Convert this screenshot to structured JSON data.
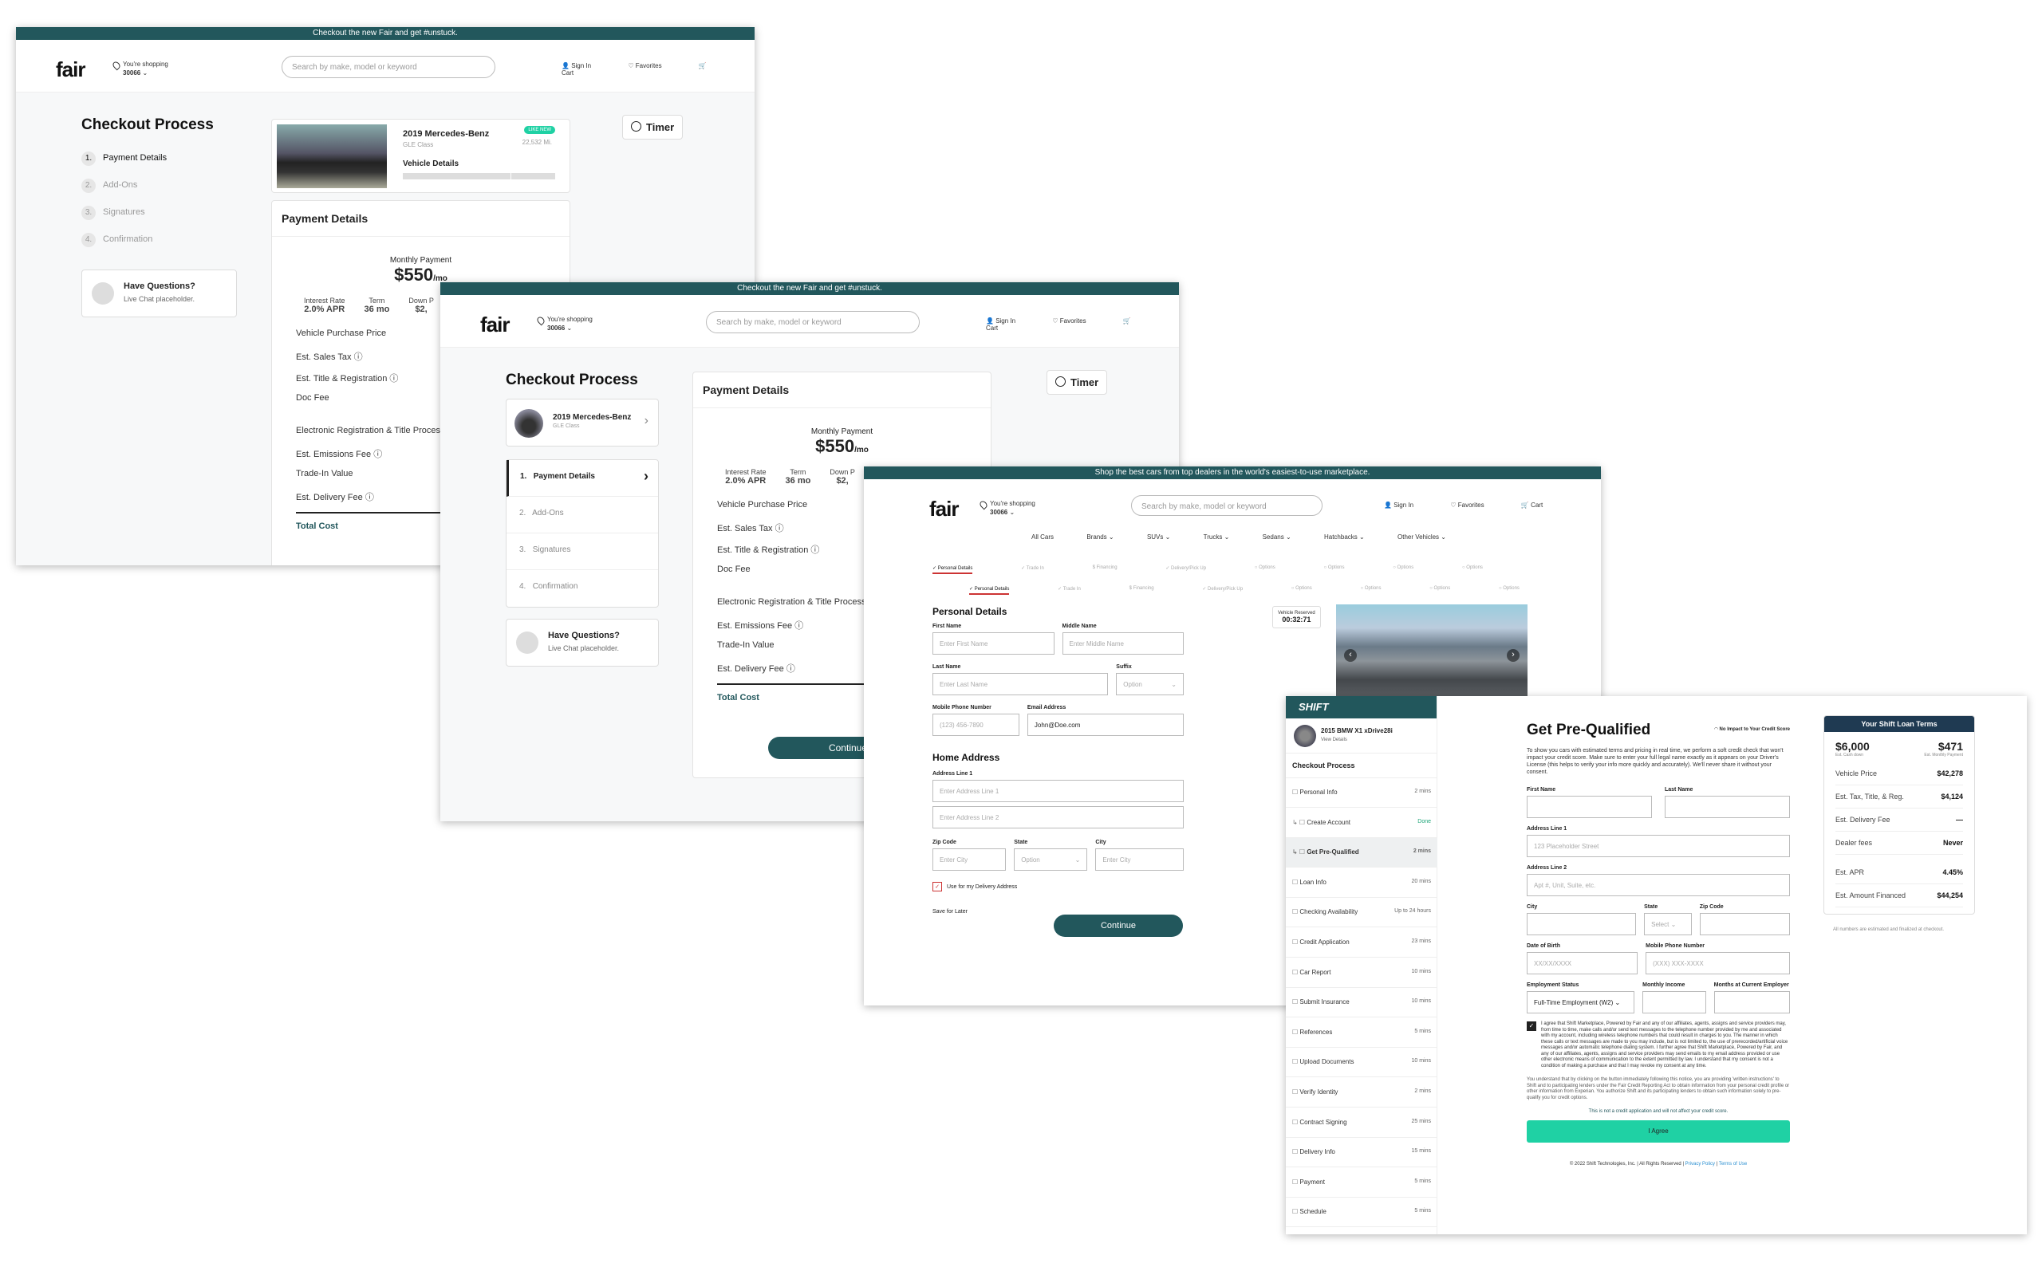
{
  "brand": {
    "logo": "fair",
    "primary": "#22575c",
    "accent": "#1fd1a4",
    "shift_logo": "SHIFT"
  },
  "promo_fair": "Checkout the new Fair and get #unstuck.",
  "promo_shift": "Shop the best cars from top dealers in the world's easiest-to-use marketplace.",
  "header": {
    "shopping_label": "You're shopping",
    "zip": "30066",
    "search_placeholder": "Search by make, model or keyword",
    "sign_in": "Sign In",
    "favorites": "Favorites",
    "cart": "Cart"
  },
  "checkout": {
    "title": "Checkout Process",
    "steps": [
      {
        "num": "1.",
        "label": "Payment Details"
      },
      {
        "num": "2.",
        "label": "Add-Ons"
      },
      {
        "num": "3.",
        "label": "Signatures"
      },
      {
        "num": "4.",
        "label": "Confirmation"
      }
    ],
    "questions_title": "Have Questions?",
    "questions_sub": "Live Chat placeholder.",
    "timer": "Timer"
  },
  "vehicle": {
    "name": "2019 Mercedes-Benz",
    "trim": "GLE Class",
    "badge": "LIKE NEW",
    "miles": "22,532 Mi.",
    "details_label": "Vehicle Details"
  },
  "payment": {
    "title": "Payment Details",
    "monthly_label": "Monthly Payment",
    "monthly_value": "$550",
    "monthly_unit": "/mo",
    "interest_label": "Interest Rate",
    "interest_value": "2.0% APR",
    "term_label": "Term",
    "term_value": "36 mo",
    "down_label": "Down P",
    "down_value": "$2,",
    "lines": [
      "Vehicle Purchase Price",
      "Est. Sales Tax",
      "Est. Title & Registration",
      "Doc Fee",
      "Electronic Registration & Title Processin",
      "Est. Emissions Fee",
      "Trade-In Value",
      "Est. Delivery Fee"
    ],
    "total": "Total Cost",
    "continue": "Continue"
  },
  "form": {
    "categories": [
      "All Cars",
      "Brands",
      "SUVs",
      "Trucks",
      "Sedans",
      "Hatchbacks",
      "Other Vehicles"
    ],
    "tabs": [
      "Personal Details",
      "Trade In",
      "Financing",
      "Delivery/Pick Up",
      "Options",
      "Options",
      "Options",
      "Options"
    ],
    "section_personal": "Personal Details",
    "first_name": "First Name",
    "first_ph": "Enter First Name",
    "middle_name": "Middle Name",
    "middle_ph": "Enter Middle Name",
    "last_name": "Last Name",
    "last_ph": "Enter Last Name",
    "suffix": "Suffix",
    "suffix_ph": "Option",
    "phone": "Mobile Phone Number",
    "phone_ph": "(123) 456-7890",
    "email": "Email Address",
    "email_val": "John@Doe.com",
    "section_home": "Home Address",
    "addr1": "Address Line 1",
    "addr1_ph": "Enter Address Line 1",
    "addr2_ph": "Enter Address Line 2",
    "zip": "Zip Code",
    "zip_ph": "Enter City",
    "state": "State",
    "state_ph": "Option",
    "city": "City",
    "city_ph": "Enter City",
    "delivery_check": "Use for my Delivery Address",
    "save_later": "Save for Later",
    "continue": "Continue",
    "reserved_label": "Vehicle Reserved",
    "reserved_time": "00:32:71"
  },
  "shift": {
    "car": "2015 BMW X1 xDrive28i",
    "view_details": "View Details",
    "checkout": "Checkout Process",
    "steps": [
      {
        "label": "Personal Info",
        "time": "2 mins"
      },
      {
        "label": "Create Account",
        "time": "Done"
      },
      {
        "label": "Get Pre-Qualified",
        "time": "2 mins"
      },
      {
        "label": "Loan Info",
        "time": "20 mins"
      },
      {
        "label": "Checking Availability",
        "time": "Up to 24 hours"
      },
      {
        "label": "Credit Application",
        "time": "23 mins"
      },
      {
        "label": "Car Report",
        "time": "10 mins"
      },
      {
        "label": "Submit Insurance",
        "time": "10 mins"
      },
      {
        "label": "References",
        "time": "5 mins"
      },
      {
        "label": "Upload Documents",
        "time": "10 mins"
      },
      {
        "label": "Verify Identity",
        "time": "2 mins"
      },
      {
        "label": "Contract Signing",
        "time": "25 mins"
      },
      {
        "label": "Delivery Info",
        "time": "15 mins"
      },
      {
        "label": "Payment",
        "time": "5 mins"
      },
      {
        "label": "Schedule",
        "time": "5 mins"
      }
    ],
    "title": "Get Pre-Qualified",
    "no_impact": "No Impact to Your Credit Score",
    "intro": "To show you cars with estimated terms and pricing in real time, we perform a soft credit check that won't impact your credit score. Make sure to enter your full legal name exactly as it appears on your Driver's License (this helps to verify your info more quickly and accurately). We'll never share it without your consent.",
    "first_name": "First Name",
    "last_name": "Last Name",
    "addr1": "Address Line 1",
    "addr1_ph": "123 Placeholder Street",
    "addr2": "Address Line 2",
    "addr2_ph": "Apt #, Unit, Suite, etc.",
    "city": "City",
    "state": "State",
    "state_ph": "Select",
    "zip": "Zip Code",
    "dob": "Date of Birth",
    "dob_ph": "XX/XX/XXXX",
    "phone": "Mobile Phone Number",
    "phone_ph": "(XXX) XXX-XXXX",
    "employment": "Employment Status",
    "employment_val": "Full-Time Employment (W2)",
    "income": "Monthly Income",
    "months": "Months at Current Employer",
    "consent": "I agree that Shift Marketplace, Powered by Fair and any of our affiliates, agents, assigns and service providers may, from time to time, make calls and/or send text messages to the telephone number provided by me and associated with my account, including wireless telephone numbers that could result in charges to you. The manner in which these calls or text messages are made to you may include, but is not limited to, the use of prerecorded/artificial voice messages and/or automatic telephone dialing system. I further agree that Shift Marketplace, Powered by Fair, and any of our affiliates, agents, assigns and service providers may send emails to my email address provided or use other electronic means of communication to the extent permitted by law. I understand that my consent is not a condition of making a purchase and that I may revoke my consent at any time.",
    "fcra": "You understand that by clicking on the button immediately following this notice, you are providing 'written instructions' to Shift and to participating lenders under the Fair Credit Reporting Act to obtain information from your personal credit profile or other information from Experian. You authorize Shift and its participating lenders to obtain such information solely to pre-qualify you for credit options.",
    "not_credit_app": "This is not a credit application and will not affect your credit score.",
    "agree": "I Agree",
    "footer": "© 2022 Shift Technologies, Inc.  |  All Rights Reserved  |",
    "privacy": "Privacy Policy",
    "terms": "Terms of Use",
    "loan_title": "Your Shift Loan Terms",
    "cash_down": "$6,000",
    "cash_down_label": "Est. Cash down",
    "monthly": "$471",
    "monthly_label": "Est. Monthly Payment",
    "loan_rows": [
      {
        "k": "Vehicle Price",
        "v": "$42,278"
      },
      {
        "k": "Est. Tax, Title, & Reg.",
        "v": "$4,124"
      },
      {
        "k": "Est. Delivery Fee",
        "v": "—"
      },
      {
        "k": "Dealer fees",
        "v": "Never"
      },
      {
        "k": "Est. APR",
        "v": "4.45%"
      },
      {
        "k": "Est. Amount Financed",
        "v": "$44,254"
      }
    ],
    "loan_note": "All numbers are estimated and finalized at checkout."
  }
}
